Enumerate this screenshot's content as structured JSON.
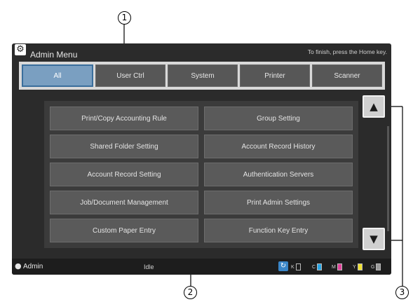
{
  "callouts": {
    "c1": "1",
    "c2": "2",
    "c3": "3"
  },
  "header": {
    "title": "Admin Menu",
    "hint": "To finish, press the Home key.",
    "gear_icon": "gear-icon"
  },
  "tabs": [
    {
      "label": "All",
      "active": true
    },
    {
      "label": "User Ctrl",
      "active": false
    },
    {
      "label": "System",
      "active": false
    },
    {
      "label": "Printer",
      "active": false
    },
    {
      "label": "Scanner",
      "active": false
    }
  ],
  "menu": [
    "Print/Copy Accounting Rule",
    "Group Setting",
    "Shared Folder Setting",
    "Account Record History",
    "Account Record Setting",
    "Authentication Servers",
    "Job/Document Management",
    "Print Admin Settings",
    "Custom Paper Entry",
    "Function Key Entry"
  ],
  "scroll": {
    "up_icon": "triangle-up-icon",
    "down_icon": "triangle-down-icon"
  },
  "status": {
    "user": "Admin",
    "state": "Idle",
    "inks": [
      {
        "label": "K",
        "color": "#ffffff",
        "level": 0.0
      },
      {
        "label": "C",
        "color": "#29a7e6",
        "level": 1.0
      },
      {
        "label": "M",
        "color": "#e0449b",
        "level": 1.0
      },
      {
        "label": "Y",
        "color": "#f0e030",
        "level": 1.0
      },
      {
        "label": "G",
        "color": "#9a9a9a",
        "level": 1.0
      }
    ]
  },
  "colors": {
    "screen_bg": "#2b2b2b",
    "tab_active": "#7a9fc1",
    "accent_blue": "#3a6e9c"
  }
}
